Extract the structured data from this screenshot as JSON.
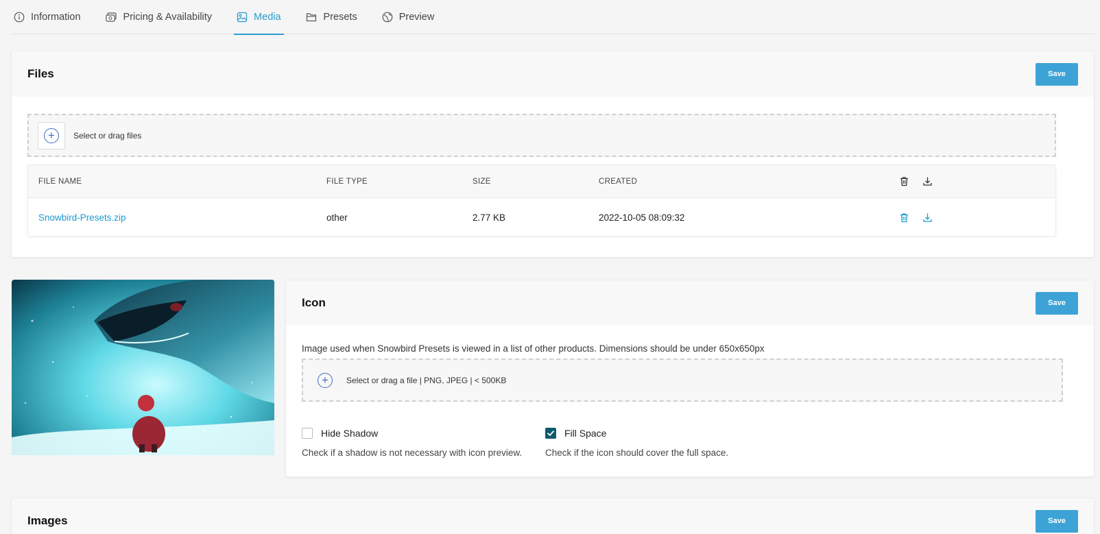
{
  "tabs": [
    {
      "label": "Information",
      "icon": "info-icon"
    },
    {
      "label": "Pricing & Availability",
      "icon": "pricing-icon"
    },
    {
      "label": "Media",
      "icon": "image-icon"
    },
    {
      "label": "Presets",
      "icon": "folder-icon"
    },
    {
      "label": "Preview",
      "icon": "globe-icon"
    }
  ],
  "active_tab": "Media",
  "colors": {
    "accent": "#2a9bd1",
    "save_button": "#3da3d6",
    "checkbox_on": "#0f5a6b"
  },
  "files": {
    "title": "Files",
    "save_label": "Save",
    "dropzone_text": "Select or drag files",
    "columns": [
      "FILE NAME",
      "FILE TYPE",
      "SIZE",
      "CREATED"
    ],
    "rows": [
      {
        "name": "Snowbird-Presets.zip",
        "type": "other",
        "size": "2.77 KB",
        "created": "2022-10-05 08:09:32"
      }
    ]
  },
  "icon_section": {
    "title": "Icon",
    "save_label": "Save",
    "description": "Image used when Snowbird Presets is viewed in a list of other products. Dimensions should be under 650x650px",
    "dropzone_text": "Select or drag a file | PNG, JPEG | < 500KB",
    "hide_shadow": {
      "label": "Hide Shadow",
      "checked": false,
      "help": "Check if a shadow is not necessary with icon preview."
    },
    "fill_space": {
      "label": "Fill Space",
      "checked": true,
      "help": "Check if the icon should cover the full space."
    }
  },
  "images": {
    "title": "Images",
    "save_label": "Save"
  }
}
